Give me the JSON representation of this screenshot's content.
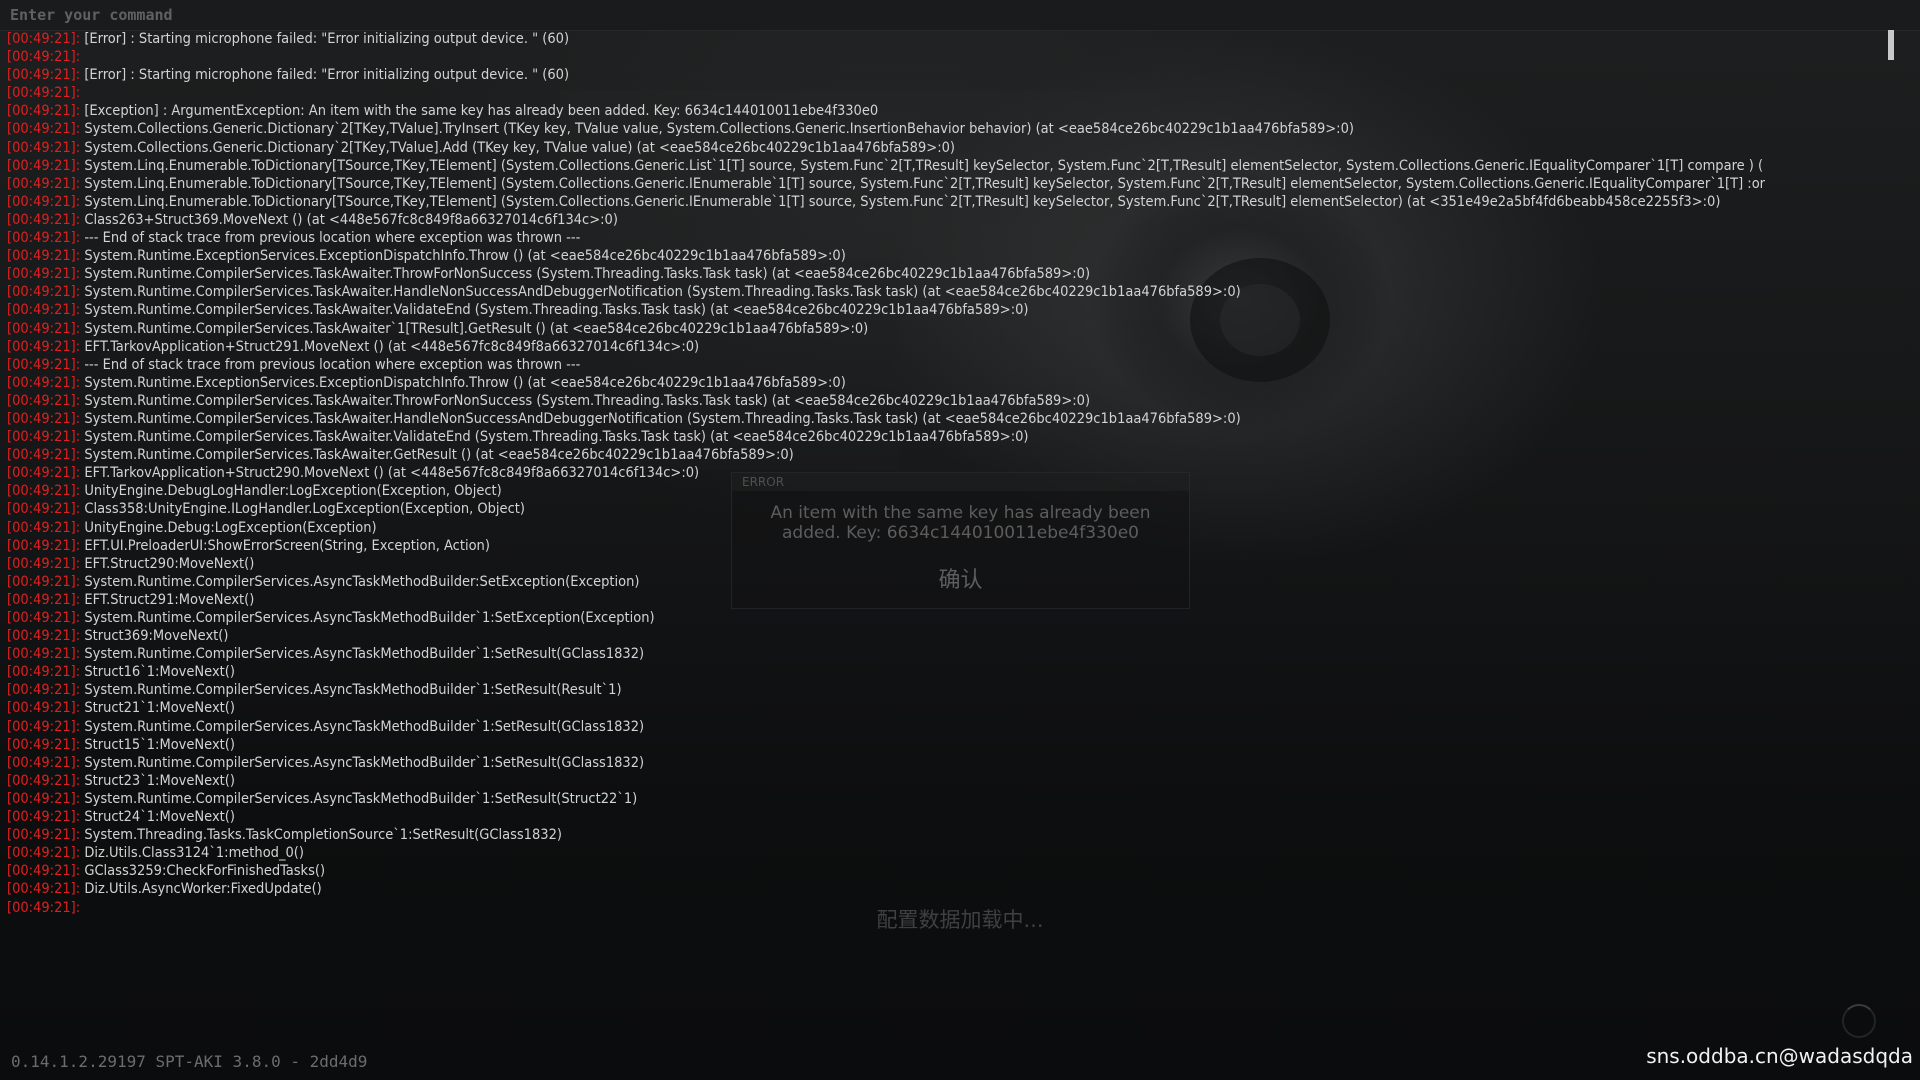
{
  "command": {
    "placeholder": "Enter your command"
  },
  "log": [
    {
      "time": "[00:49:21]:",
      "text": "[Error] : Starting microphone failed: \"Error initializing output device. \" (60)"
    },
    {
      "time": "[00:49:21]:",
      "text": ""
    },
    {
      "time": "[00:49:21]:",
      "text": "[Error] : Starting microphone failed: \"Error initializing output device. \" (60)"
    },
    {
      "time": "[00:49:21]:",
      "text": ""
    },
    {
      "time": "[00:49:21]:",
      "text": "[Exception] : ArgumentException: An item with the same key has already been added. Key: 6634c144010011ebe4f330e0"
    },
    {
      "time": "[00:49:21]:",
      "text": "System.Collections.Generic.Dictionary`2[TKey,TValue].TryInsert (TKey key, TValue value, System.Collections.Generic.InsertionBehavior behavior) (at <eae584ce26bc40229c1b1aa476bfa589>:0)"
    },
    {
      "time": "[00:49:21]:",
      "text": "System.Collections.Generic.Dictionary`2[TKey,TValue].Add (TKey key, TValue value) (at <eae584ce26bc40229c1b1aa476bfa589>:0)"
    },
    {
      "time": "[00:49:21]:",
      "text": "System.Linq.Enumerable.ToDictionary[TSource,TKey,TElement] (System.Collections.Generic.List`1[T] source, System.Func`2[T,TResult] keySelector, System.Func`2[T,TResult] elementSelector, System.Collections.Generic.IEqualityComparer`1[T] compare ) ("
    },
    {
      "time": "[00:49:21]:",
      "text": "System.Linq.Enumerable.ToDictionary[TSource,TKey,TElement] (System.Collections.Generic.IEnumerable`1[T] source, System.Func`2[T,TResult] keySelector, System.Func`2[T,TResult] elementSelector, System.Collections.Generic.IEqualityComparer`1[T] :or"
    },
    {
      "time": "[00:49:21]:",
      "text": "System.Linq.Enumerable.ToDictionary[TSource,TKey,TElement] (System.Collections.Generic.IEnumerable`1[T] source, System.Func`2[T,TResult] keySelector, System.Func`2[T,TResult] elementSelector) (at <351e49e2a5bf4fd6beabb458ce2255f3>:0)"
    },
    {
      "time": "[00:49:21]:",
      "text": "Class263+Struct369.MoveNext () (at <448e567fc8c849f8a66327014c6f134c>:0)"
    },
    {
      "time": "[00:49:21]:",
      "text": "--- End of stack trace from previous location where exception was thrown ---"
    },
    {
      "time": "[00:49:21]:",
      "text": "System.Runtime.ExceptionServices.ExceptionDispatchInfo.Throw () (at <eae584ce26bc40229c1b1aa476bfa589>:0)"
    },
    {
      "time": "[00:49:21]:",
      "text": "System.Runtime.CompilerServices.TaskAwaiter.ThrowForNonSuccess (System.Threading.Tasks.Task task) (at <eae584ce26bc40229c1b1aa476bfa589>:0)"
    },
    {
      "time": "[00:49:21]:",
      "text": "System.Runtime.CompilerServices.TaskAwaiter.HandleNonSuccessAndDebuggerNotification (System.Threading.Tasks.Task task) (at <eae584ce26bc40229c1b1aa476bfa589>:0)"
    },
    {
      "time": "[00:49:21]:",
      "text": "System.Runtime.CompilerServices.TaskAwaiter.ValidateEnd (System.Threading.Tasks.Task task) (at <eae584ce26bc40229c1b1aa476bfa589>:0)"
    },
    {
      "time": "[00:49:21]:",
      "text": "System.Runtime.CompilerServices.TaskAwaiter`1[TResult].GetResult () (at <eae584ce26bc40229c1b1aa476bfa589>:0)"
    },
    {
      "time": "[00:49:21]:",
      "text": "EFT.TarkovApplication+Struct291.MoveNext () (at <448e567fc8c849f8a66327014c6f134c>:0)"
    },
    {
      "time": "[00:49:21]:",
      "text": "--- End of stack trace from previous location where exception was thrown ---"
    },
    {
      "time": "[00:49:21]:",
      "text": "System.Runtime.ExceptionServices.ExceptionDispatchInfo.Throw () (at <eae584ce26bc40229c1b1aa476bfa589>:0)"
    },
    {
      "time": "[00:49:21]:",
      "text": "System.Runtime.CompilerServices.TaskAwaiter.ThrowForNonSuccess (System.Threading.Tasks.Task task) (at <eae584ce26bc40229c1b1aa476bfa589>:0)"
    },
    {
      "time": "[00:49:21]:",
      "text": "System.Runtime.CompilerServices.TaskAwaiter.HandleNonSuccessAndDebuggerNotification (System.Threading.Tasks.Task task) (at <eae584ce26bc40229c1b1aa476bfa589>:0)"
    },
    {
      "time": "[00:49:21]:",
      "text": "System.Runtime.CompilerServices.TaskAwaiter.ValidateEnd (System.Threading.Tasks.Task task) (at <eae584ce26bc40229c1b1aa476bfa589>:0)"
    },
    {
      "time": "[00:49:21]:",
      "text": "System.Runtime.CompilerServices.TaskAwaiter.GetResult () (at <eae584ce26bc40229c1b1aa476bfa589>:0)"
    },
    {
      "time": "[00:49:21]:",
      "text": "EFT.TarkovApplication+Struct290.MoveNext () (at <448e567fc8c849f8a66327014c6f134c>:0)"
    },
    {
      "time": "[00:49:21]:",
      "text": "UnityEngine.DebugLogHandler:LogException(Exception, Object)"
    },
    {
      "time": "[00:49:21]:",
      "text": "Class358:UnityEngine.ILogHandler.LogException(Exception, Object)"
    },
    {
      "time": "[00:49:21]:",
      "text": "UnityEngine.Debug:LogException(Exception)"
    },
    {
      "time": "[00:49:21]:",
      "text": "EFT.UI.PreloaderUI:ShowErrorScreen(String, Exception, Action)"
    },
    {
      "time": "[00:49:21]:",
      "text": "EFT.Struct290:MoveNext()"
    },
    {
      "time": "[00:49:21]:",
      "text": "System.Runtime.CompilerServices.AsyncTaskMethodBuilder:SetException(Exception)"
    },
    {
      "time": "[00:49:21]:",
      "text": "EFT.Struct291:MoveNext()"
    },
    {
      "time": "[00:49:21]:",
      "text": "System.Runtime.CompilerServices.AsyncTaskMethodBuilder`1:SetException(Exception)"
    },
    {
      "time": "[00:49:21]:",
      "text": "Struct369:MoveNext()"
    },
    {
      "time": "[00:49:21]:",
      "text": "System.Runtime.CompilerServices.AsyncTaskMethodBuilder`1:SetResult(GClass1832)"
    },
    {
      "time": "[00:49:21]:",
      "text": "Struct16`1:MoveNext()"
    },
    {
      "time": "[00:49:21]:",
      "text": "System.Runtime.CompilerServices.AsyncTaskMethodBuilder`1:SetResult(Result`1)"
    },
    {
      "time": "[00:49:21]:",
      "text": "Struct21`1:MoveNext()"
    },
    {
      "time": "[00:49:21]:",
      "text": "System.Runtime.CompilerServices.AsyncTaskMethodBuilder`1:SetResult(GClass1832)"
    },
    {
      "time": "[00:49:21]:",
      "text": "Struct15`1:MoveNext()"
    },
    {
      "time": "[00:49:21]:",
      "text": "System.Runtime.CompilerServices.AsyncTaskMethodBuilder`1:SetResult(GClass1832)"
    },
    {
      "time": "[00:49:21]:",
      "text": "Struct23`1:MoveNext()"
    },
    {
      "time": "[00:49:21]:",
      "text": "System.Runtime.CompilerServices.AsyncTaskMethodBuilder`1:SetResult(Struct22`1)"
    },
    {
      "time": "[00:49:21]:",
      "text": "Struct24`1:MoveNext()"
    },
    {
      "time": "[00:49:21]:",
      "text": "System.Threading.Tasks.TaskCompletionSource`1:SetResult(GClass1832)"
    },
    {
      "time": "[00:49:21]:",
      "text": "Diz.Utils.Class3124`1:method_0()"
    },
    {
      "time": "[00:49:21]:",
      "text": "GClass3259:CheckForFinishedTasks()"
    },
    {
      "time": "[00:49:21]:",
      "text": "Diz.Utils.AsyncWorker:FixedUpdate()"
    },
    {
      "time": "[00:49:21]:",
      "text": ""
    }
  ],
  "error_dialog": {
    "title": "ERROR",
    "message": "An item with the same key has already been added. Key: 6634c144010011ebe4f330e0",
    "confirm_label": "确认"
  },
  "loading": {
    "text": "配置数据加载中..."
  },
  "footer": {
    "version": "0.14.1.2.29197 SPT-AKI 3.8.0 - 2dd4d9",
    "watermark": "sns.oddba.cn@wadasdqda"
  },
  "colors": {
    "timestamp": "#e02020",
    "log_text": "#d2d3d4",
    "background": "#0c0d0e"
  }
}
